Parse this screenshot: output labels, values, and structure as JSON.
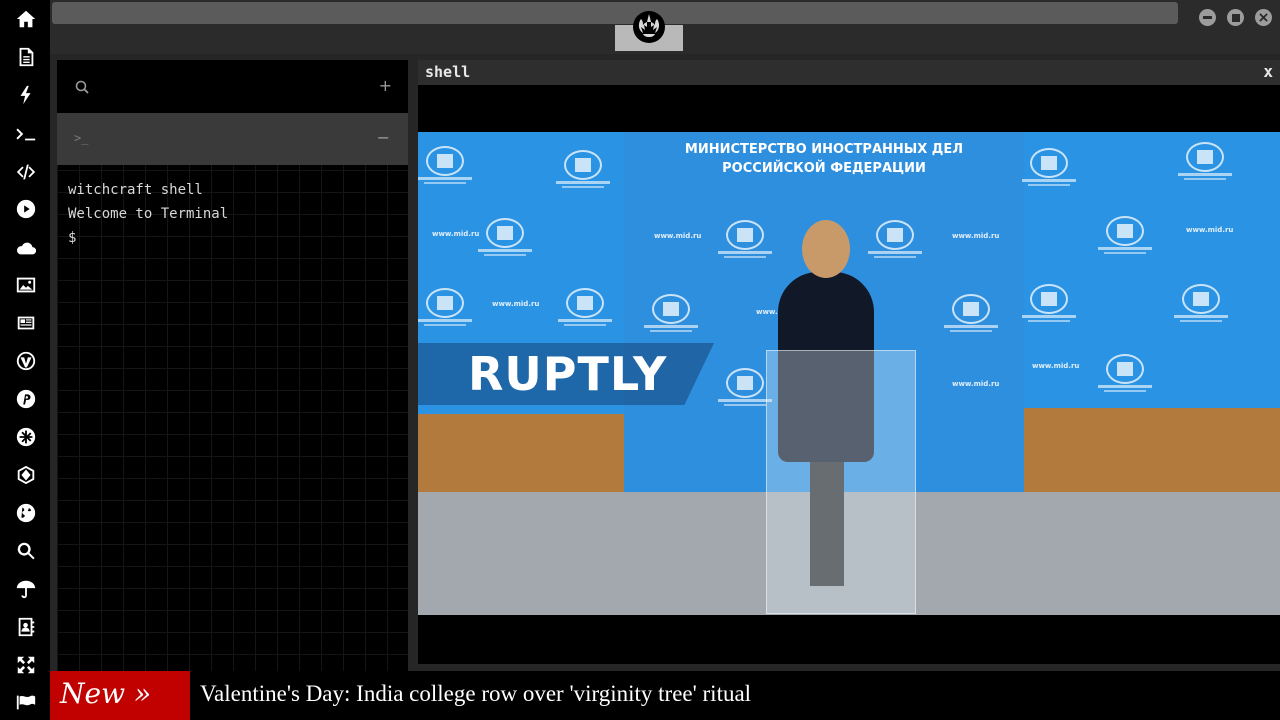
{
  "rail": {
    "icons": [
      "home-icon",
      "document-icon",
      "bolt-icon",
      "terminal-icon",
      "code-icon",
      "play-icon",
      "cloud-icon",
      "image-icon",
      "newspaper-icon",
      "wordpress-icon",
      "pinterest-icon",
      "snowflake-icon",
      "globe-grid-icon",
      "globe-icon",
      "search-icon",
      "umbrella-icon",
      "contacts-icon",
      "expand-icon",
      "flag-icon"
    ]
  },
  "topbar": {
    "logo_icon": "rebel-alliance-icon",
    "window_buttons": [
      "minimize-icon",
      "maximize-icon",
      "close-icon"
    ]
  },
  "terminal_panel": {
    "add_label": "+",
    "tab_prompt": ">_",
    "tab_close": "−",
    "lines": [
      "witchcraft shell",
      "Welcome to Terminal",
      "$"
    ]
  },
  "shell_window": {
    "title": "shell",
    "close_label": "x"
  },
  "video": {
    "backdrop_heading_line1": "МИНИСТЕРСТВО ИНОСТРАННЫХ ДЕЛ",
    "backdrop_heading_line2": "РОССИЙСКОЙ ФЕДЕРАЦИИ",
    "watermark": "www.mid.ru",
    "logo_text": "RUPTLY"
  },
  "ticker": {
    "badge": "New »",
    "headline": "Valentine's Day: India college row over 'virginity tree' ritual"
  },
  "colors": {
    "ticker_badge": "#c10000",
    "backdrop_blue": "#1f86d6",
    "rail": "#000000"
  }
}
